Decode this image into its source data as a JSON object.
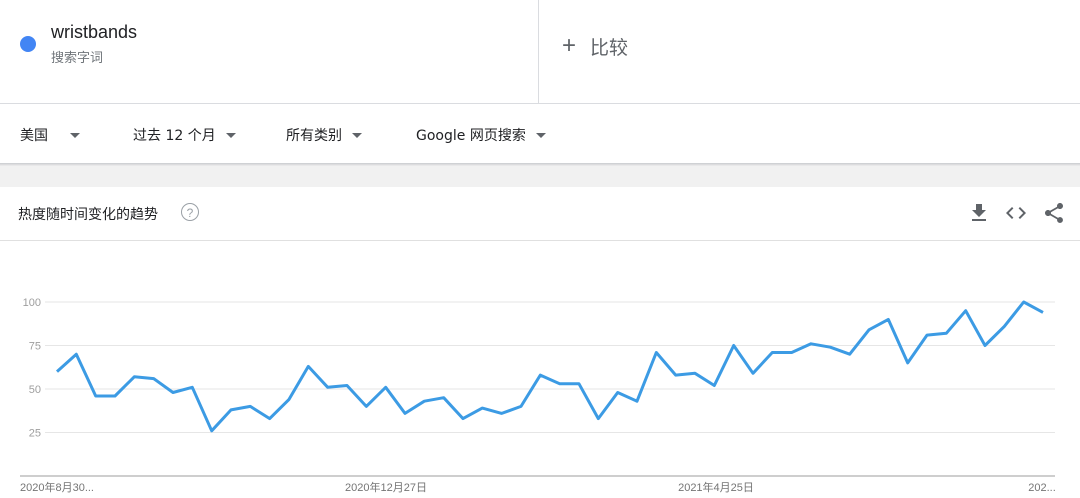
{
  "search_term": {
    "name": "wristbands",
    "type": "搜索字词",
    "color": "#4285f4"
  },
  "compare": {
    "label": "比较"
  },
  "filters": {
    "region": "美国",
    "time_range": "过去 12 个月",
    "category": "所有类别",
    "search_type": "Google 网页搜索"
  },
  "chart_card": {
    "title": "热度随时间变化的趋势",
    "help_icon": "help-icon",
    "actions": [
      "download-icon",
      "embed-code-icon",
      "share-icon"
    ]
  },
  "chart_data": {
    "type": "line",
    "series": [
      {
        "color": "#3c9be4",
        "values": [
          60,
          70,
          46,
          46,
          57,
          56,
          48,
          51,
          26,
          38,
          40,
          33,
          44,
          63,
          51,
          52,
          40,
          51,
          36,
          43,
          45,
          33,
          39,
          36,
          40,
          58,
          53,
          53,
          33,
          48,
          43,
          71,
          58,
          59,
          52,
          75,
          59,
          71,
          71,
          76,
          74,
          70,
          84,
          90,
          65,
          81,
          82,
          95,
          75,
          86,
          100,
          94
        ]
      }
    ],
    "yticks": [
      25,
      50,
      75,
      100
    ],
    "ylim": [
      0,
      100
    ],
    "xtick_labels": [
      "2020年8月30...",
      "2020年12月27日",
      "2021年4月25日",
      "202..."
    ],
    "grid": true
  }
}
